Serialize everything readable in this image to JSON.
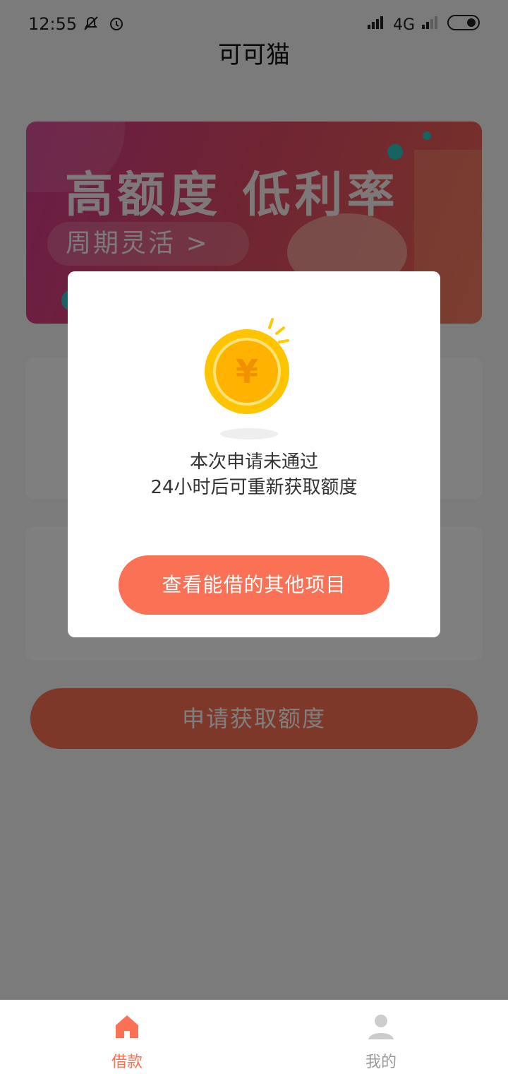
{
  "status": {
    "time": "12:55",
    "network": "4G"
  },
  "nav": {
    "title": "可可猫"
  },
  "banner": {
    "title": "高额度 低利率",
    "pill": "周期灵活 >"
  },
  "main": {
    "apply_label": "申请获取额度"
  },
  "dialog": {
    "line1": "本次申请未通过",
    "line2": "24小时后可重新获取额度",
    "button_label": "查看能借的其他项目",
    "coin_icon": "coin-yen-icon"
  },
  "tabbar": {
    "tabs": [
      {
        "label": "借款",
        "icon": "home-icon",
        "active": true,
        "color": "#fa7155"
      },
      {
        "label": "我的",
        "icon": "user-icon",
        "active": false,
        "color": "#999999"
      }
    ]
  },
  "colors": {
    "accent": "#fa7155",
    "overlay": "rgba(0,0,0,0.5)"
  }
}
